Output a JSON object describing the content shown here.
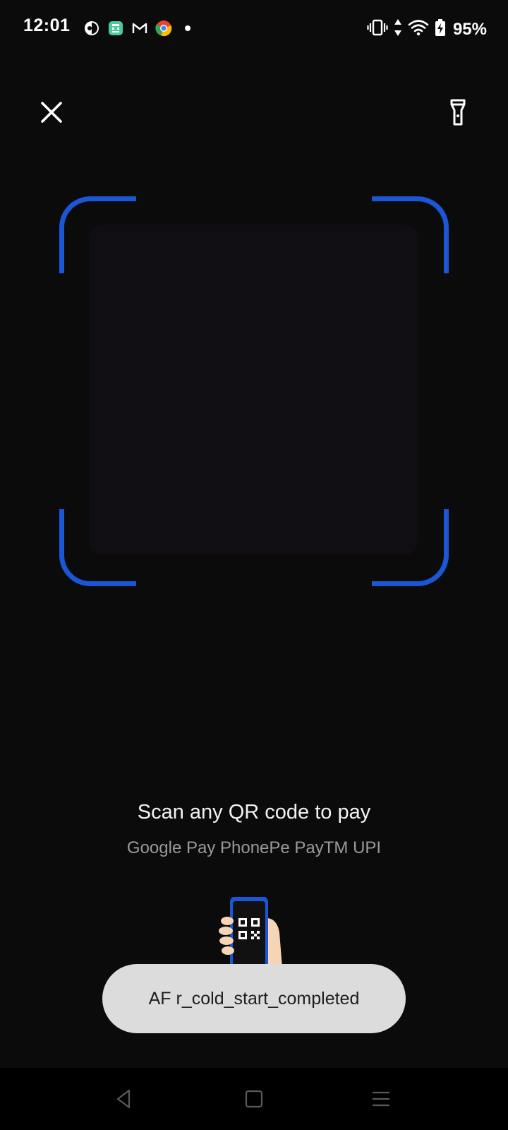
{
  "status_bar": {
    "time": "12:01",
    "notification_icons": [
      "app-icon",
      "calculator-app-icon",
      "gmail-icon",
      "chrome-icon",
      "more-dot-icon"
    ],
    "battery_percent": "95%",
    "status_icons": [
      "vibrate-icon",
      "data-arrows-icon",
      "wifi-icon",
      "battery-charging-icon"
    ]
  },
  "scanner": {
    "accent_color": "#1a56d6",
    "title": "Scan any QR code to pay",
    "subtitle": "Google Pay PhonePe PayTM UPI"
  },
  "toast": {
    "message": "AF r_cold_start_completed"
  },
  "nav_bar": {
    "buttons": [
      "back-icon",
      "home-icon",
      "recents-icon"
    ]
  }
}
